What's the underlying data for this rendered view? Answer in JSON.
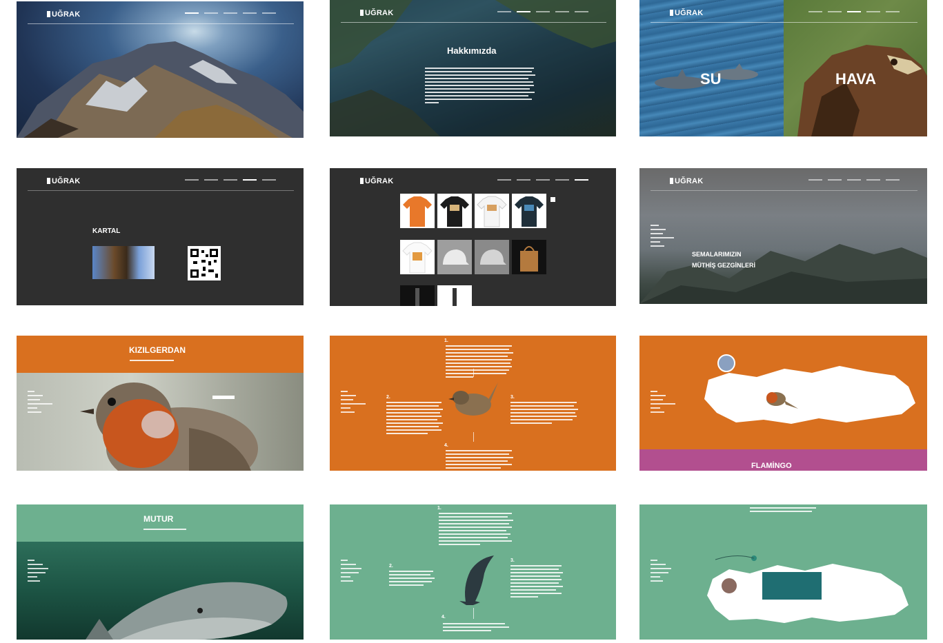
{
  "brand": {
    "logo": "UĞRAK"
  },
  "slides": {
    "s2": {
      "title": "Hakkımızda"
    },
    "s3": {
      "left": "SU",
      "right": "HAVA"
    },
    "s4": {
      "title": "KARTAL"
    },
    "s6": {
      "title_line1": "SEMALARIMIZIN",
      "title_line2": "MÜTHİŞ GEZGİNLERİ"
    },
    "s7": {
      "title": "KIZILGERDAN"
    },
    "s8": {
      "n1": "1.",
      "n2": "2.",
      "n3": "3.",
      "n4": "4."
    },
    "s9": {
      "footer": "FLAMİNGO"
    },
    "s10": {
      "title": "MUTUR"
    },
    "s11": {
      "n1": "1.",
      "n2": "2.",
      "n3": "3.",
      "n4": "4."
    }
  },
  "colors": {
    "orange": "#d9701f",
    "green": "#6db08f",
    "dark": "#2f2f2f",
    "pink": "#b24f8f"
  }
}
